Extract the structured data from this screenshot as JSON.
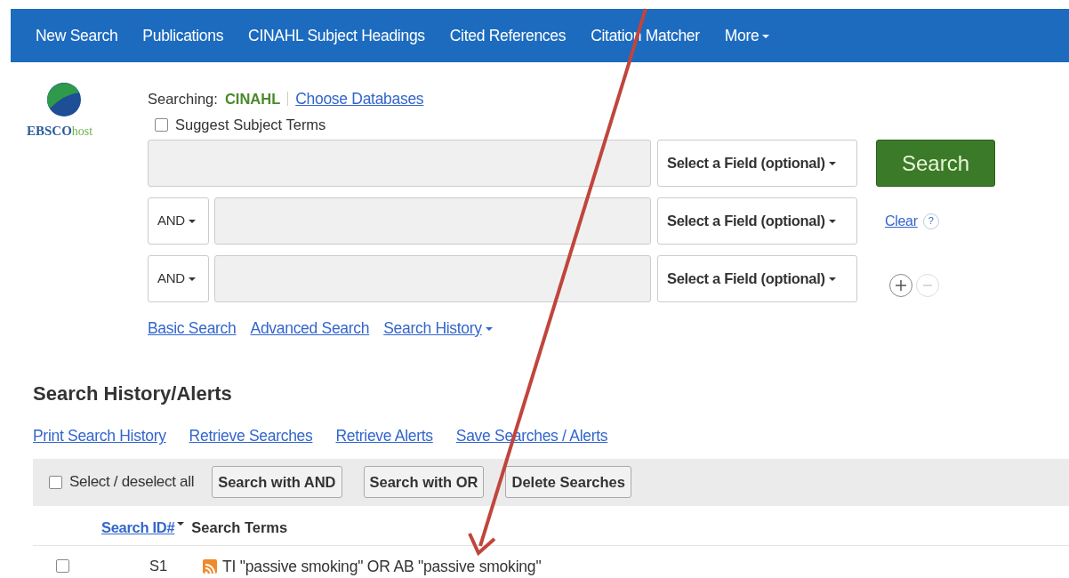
{
  "nav": [
    {
      "label": "New Search"
    },
    {
      "label": "Publications"
    },
    {
      "label": "CINAHL Subject Headings"
    },
    {
      "label": "Cited References"
    },
    {
      "label": "Citation Matcher"
    },
    {
      "label": "More",
      "caret": true
    }
  ],
  "logo": {
    "brand": "EBSCO",
    "suffix": "host"
  },
  "searching": {
    "label": "Searching:",
    "database": "CINAHL",
    "link": "Choose Databases"
  },
  "suggest": {
    "label": "Suggest Subject Terms",
    "checked": false
  },
  "rows": [
    {
      "field": "Select a Field (optional)",
      "kind": "search"
    },
    {
      "operator": "AND",
      "field": "Select a Field (optional)",
      "kind": "clear"
    },
    {
      "operator": "AND",
      "field": "Select a Field (optional)",
      "kind": "addremove"
    }
  ],
  "search_button": "Search",
  "clear_link": "Clear",
  "help": "?",
  "search_links": [
    {
      "label": "Basic Search"
    },
    {
      "label": "Advanced Search"
    },
    {
      "label": "Search History",
      "caret": true
    }
  ],
  "history": {
    "title": "Search History/Alerts",
    "links": [
      "Print Search History",
      "Retrieve Searches",
      "Retrieve Alerts",
      "Save Searches / Alerts"
    ],
    "select_all": {
      "label": "Select / deselect all",
      "checked": false
    },
    "buttons": [
      "Search with AND",
      "Search with OR",
      "Delete Searches"
    ],
    "columns": [
      {
        "label": "Search ID#",
        "sortable": true
      },
      {
        "label": "Search Terms",
        "sortable": false
      }
    ],
    "rows": [
      {
        "checked": false,
        "id": "S1",
        "terms": "TI \"passive smoking\" OR AB \"passive smoking\""
      }
    ]
  }
}
